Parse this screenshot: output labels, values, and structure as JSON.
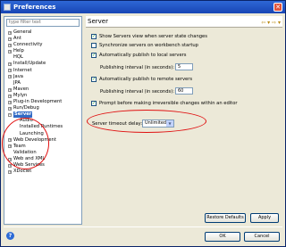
{
  "window": {
    "title": "Preferences",
    "close_glyph": "✕"
  },
  "left": {
    "filter_placeholder": "type filter text",
    "tree": [
      {
        "label": "General",
        "expandable": true,
        "child": false,
        "selected": false
      },
      {
        "label": "Ant",
        "expandable": true,
        "child": false,
        "selected": false
      },
      {
        "label": "Connectivity",
        "expandable": true,
        "child": false,
        "selected": false
      },
      {
        "label": "Help",
        "expandable": true,
        "child": false,
        "selected": false
      },
      {
        "label": "HQL",
        "expandable": false,
        "child": false,
        "selected": false
      },
      {
        "label": "Install/Update",
        "expandable": true,
        "child": false,
        "selected": false
      },
      {
        "label": "Internet",
        "expandable": true,
        "child": false,
        "selected": false
      },
      {
        "label": "Java",
        "expandable": true,
        "child": false,
        "selected": false
      },
      {
        "label": "JPA",
        "expandable": false,
        "child": false,
        "selected": false
      },
      {
        "label": "Maven",
        "expandable": true,
        "child": false,
        "selected": false
      },
      {
        "label": "Mylyn",
        "expandable": true,
        "child": false,
        "selected": false
      },
      {
        "label": "Plug-in Development",
        "expandable": true,
        "child": false,
        "selected": false
      },
      {
        "label": "Run/Debug",
        "expandable": true,
        "child": false,
        "selected": false
      },
      {
        "label": "Server",
        "expandable": true,
        "child": false,
        "selected": true
      },
      {
        "label": "Audio",
        "expandable": false,
        "child": true,
        "selected": false
      },
      {
        "label": "Installed Runtimes",
        "expandable": false,
        "child": true,
        "selected": false
      },
      {
        "label": "Launching",
        "expandable": false,
        "child": true,
        "selected": false
      },
      {
        "label": "Web Development",
        "expandable": true,
        "child": false,
        "selected": false
      },
      {
        "label": "Team",
        "expandable": true,
        "child": false,
        "selected": false
      },
      {
        "label": "Validation",
        "expandable": false,
        "child": false,
        "selected": false
      },
      {
        "label": "Web and XML",
        "expandable": true,
        "child": false,
        "selected": false
      },
      {
        "label": "Web Services",
        "expandable": true,
        "child": false,
        "selected": false
      },
      {
        "label": "XDoclet",
        "expandable": true,
        "child": false,
        "selected": false
      }
    ]
  },
  "right": {
    "page_title": "Server",
    "nav_back_glyph": "⇦ ▾ ⇨ ▾",
    "options": {
      "show_servers_view": {
        "label": "Show Servers view when server state changes",
        "checked": true
      },
      "sync_workbench": {
        "label": "Synchronize servers on workbench startup",
        "checked": false
      },
      "auto_publish_local": {
        "label": "Automatically publish to local servers",
        "checked": true
      },
      "publish_interval_local_label": "Publishing interval (in seconds):",
      "publish_interval_local_value": "5",
      "auto_publish_remote": {
        "label": "Automatically publish to remote servers",
        "checked": true
      },
      "publish_interval_remote_label": "Publishing interval (in seconds):",
      "publish_interval_remote_value": "60",
      "prompt_save": {
        "label": "Prompt before making irreversible changes within an editor",
        "checked": true
      }
    },
    "timeout_label": "Server timeout delay:",
    "timeout_value": "Unlimited",
    "check_glyph": "✓",
    "dropdown_glyph": "▼"
  },
  "buttons": {
    "restore_defaults": "Restore Defaults",
    "apply": "Apply",
    "ok": "OK",
    "cancel": "Cancel"
  },
  "help_glyph": "?",
  "annotation_color": "#e01010"
}
